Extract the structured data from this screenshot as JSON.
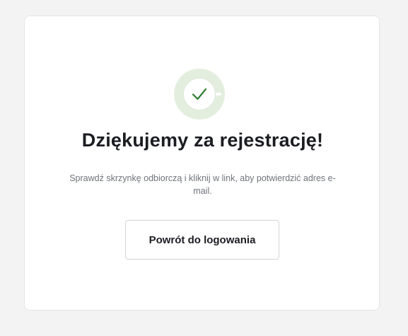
{
  "confirmation": {
    "icon": "checkmark-icon",
    "accent_color": "#2e7d32",
    "badge_color": "#e4eedf",
    "title": "Dziękujemy za rejestrację!",
    "message": "Sprawdź skrzynkę odbiorczą i kliknij w link, aby potwierdzić adres e-mail.",
    "back_button_label": "Powrót do logowania"
  }
}
